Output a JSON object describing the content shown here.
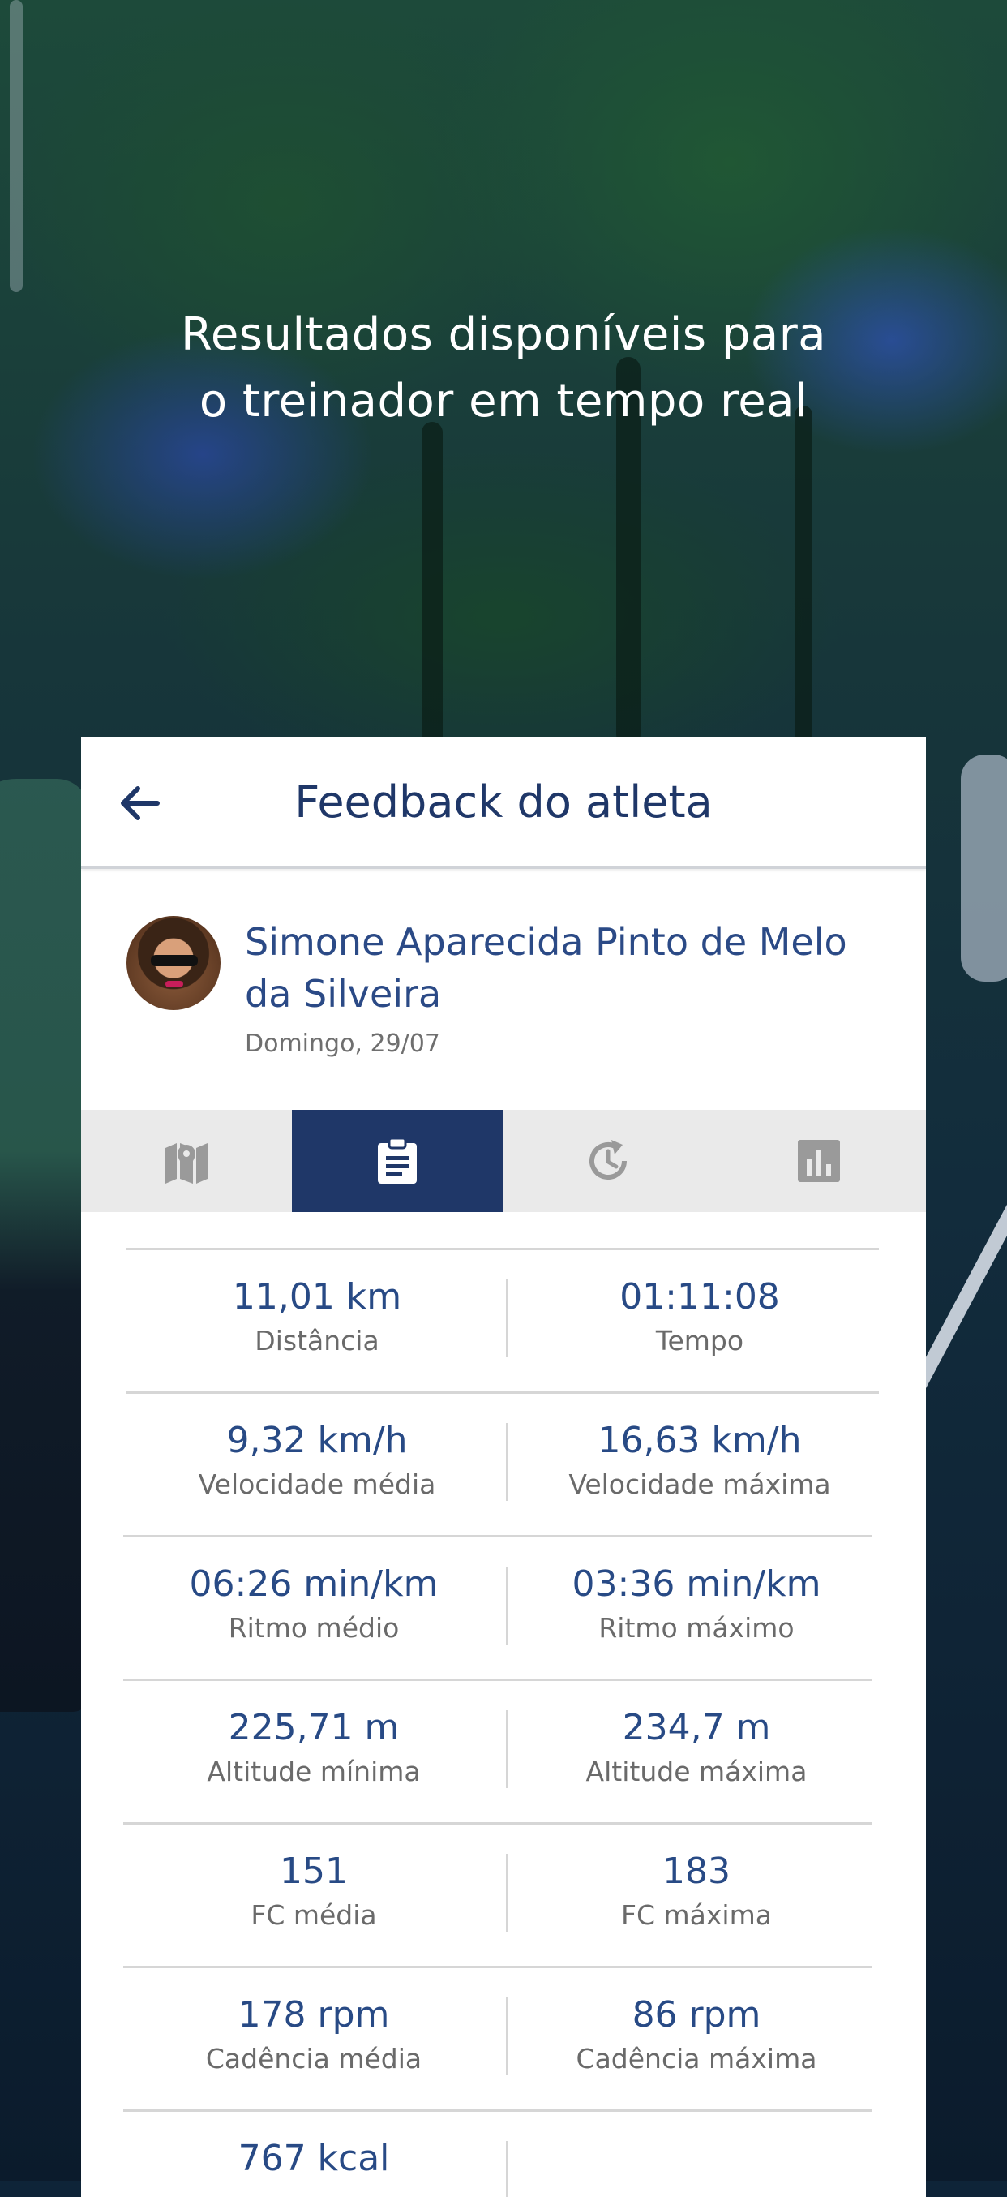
{
  "promo": {
    "headline_line1": "Resultados disponíveis para",
    "headline_line2": "o treinador em tempo real"
  },
  "header": {
    "title": "Feedback do atleta",
    "back_icon": "arrow-left-icon"
  },
  "athlete": {
    "name": "Simone Aparecida Pinto de Melo da Silveira",
    "date": "Domingo, 29/07"
  },
  "tabs": [
    {
      "icon": "map-icon",
      "active": false
    },
    {
      "icon": "clipboard-icon",
      "active": true
    },
    {
      "icon": "history-icon",
      "active": false
    },
    {
      "icon": "bar-chart-icon",
      "active": false
    }
  ],
  "colors": {
    "primary": "#1f3768",
    "value_text": "#284a85",
    "label_text": "#6a6a6a",
    "tab_bg": "#eaeaea"
  },
  "stats": [
    {
      "left_value": "11,01 km",
      "left_label": "Distância",
      "right_value": "01:11:08",
      "right_label": "Tempo"
    },
    {
      "left_value": "9,32 km/h",
      "left_label": "Velocidade média",
      "right_value": "16,63 km/h",
      "right_label": "Velocidade máxima"
    },
    {
      "left_value": "06:26 min/km",
      "left_label": "Ritmo médio",
      "right_value": "03:36 min/km",
      "right_label": "Ritmo máximo"
    },
    {
      "left_value": "225,71 m",
      "left_label": "Altitude mínima",
      "right_value": "234,7 m",
      "right_label": "Altitude máxima"
    },
    {
      "left_value": "151",
      "left_label": "FC média",
      "right_value": "183",
      "right_label": "FC máxima"
    },
    {
      "left_value": "178 rpm",
      "left_label": "Cadência média",
      "right_value": "86 rpm",
      "right_label": "Cadência máxima"
    },
    {
      "left_value": "767 kcal",
      "left_label": "",
      "right_value": "",
      "right_label": ""
    }
  ]
}
